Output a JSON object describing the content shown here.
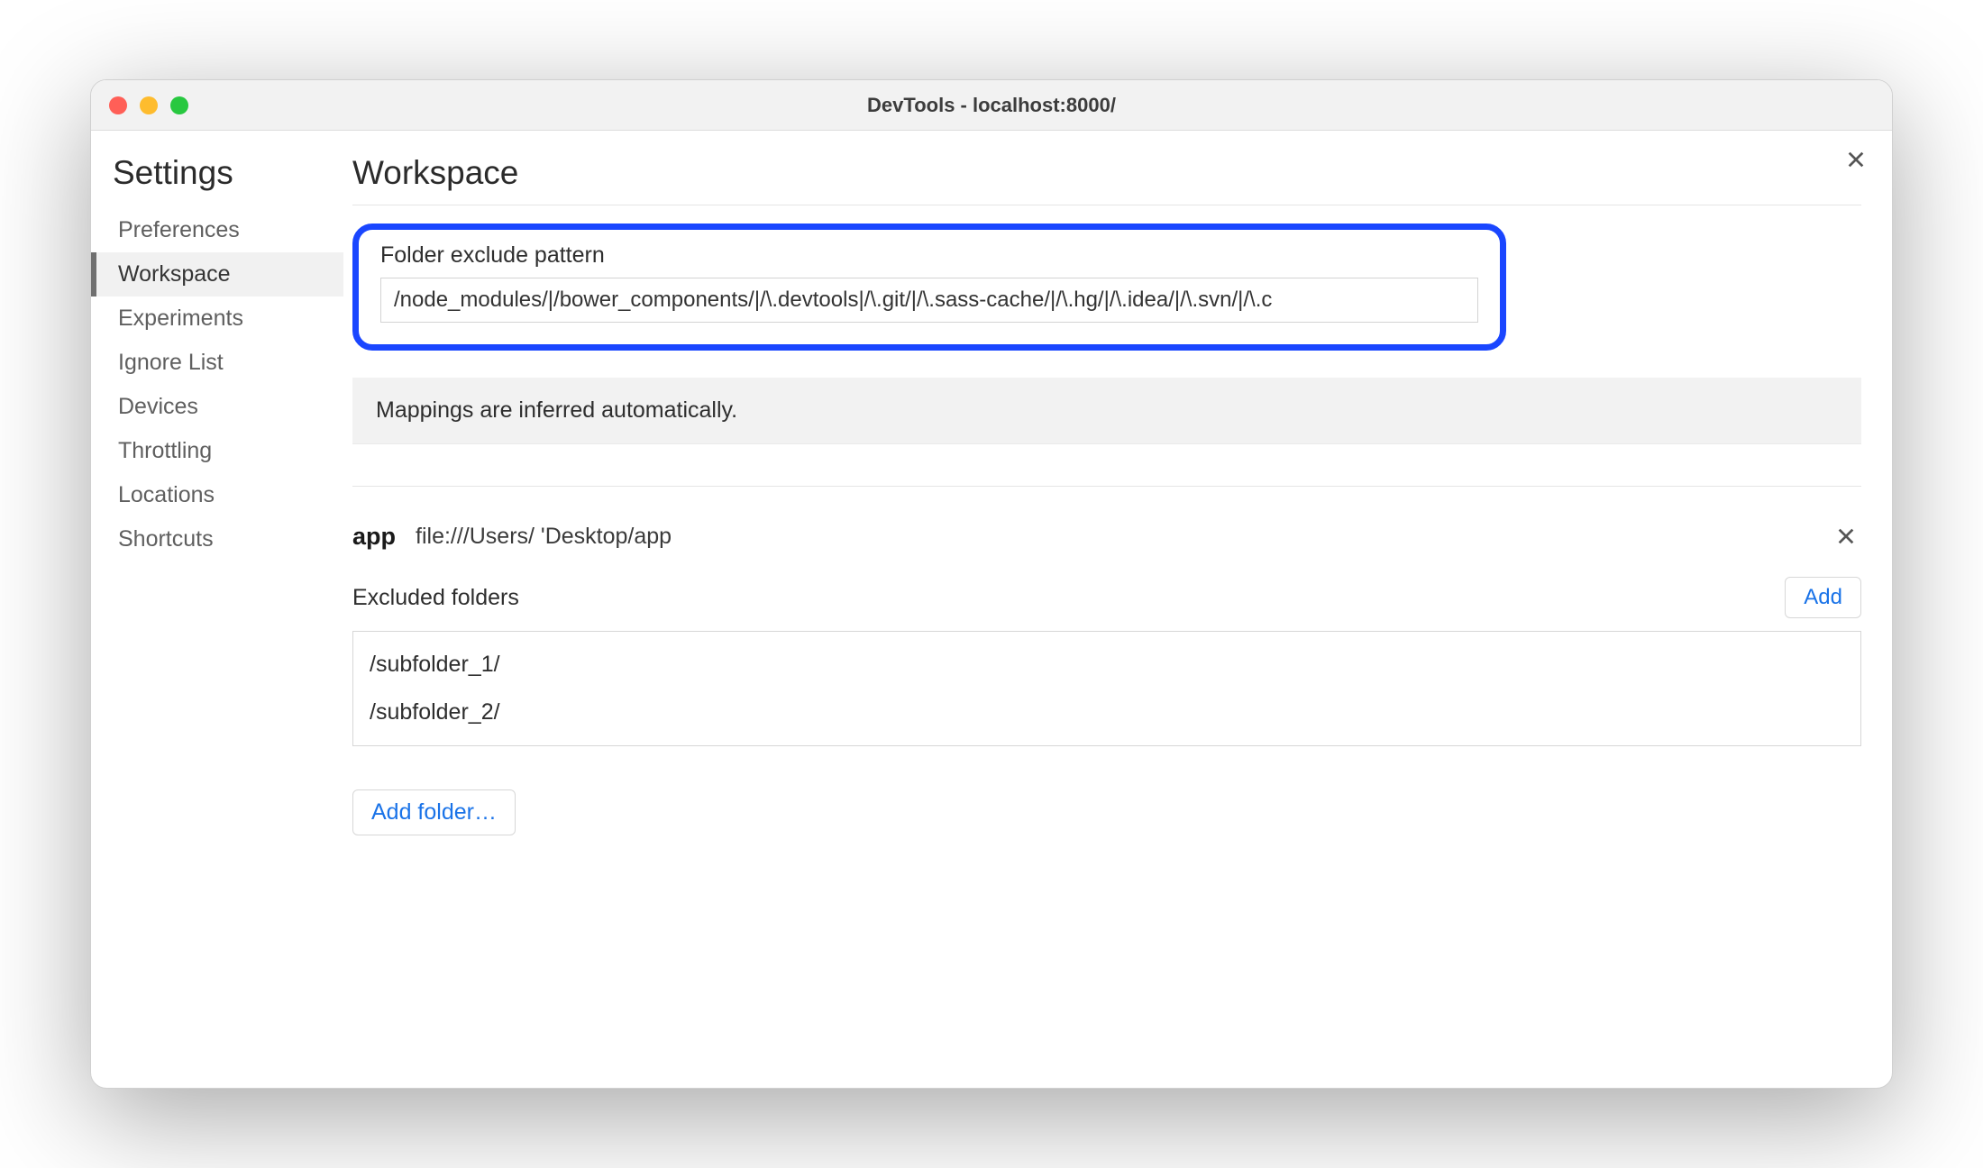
{
  "window": {
    "title": "DevTools - localhost:8000/"
  },
  "sidebar": {
    "heading": "Settings",
    "items": [
      {
        "label": "Preferences"
      },
      {
        "label": "Workspace"
      },
      {
        "label": "Experiments"
      },
      {
        "label": "Ignore List"
      },
      {
        "label": "Devices"
      },
      {
        "label": "Throttling"
      },
      {
        "label": "Locations"
      },
      {
        "label": "Shortcuts"
      }
    ],
    "active_index": 1
  },
  "main": {
    "heading": "Workspace",
    "exclude_pattern": {
      "label": "Folder exclude pattern",
      "value": "/node_modules/|/bower_components/|/\\.devtools|/\\.git/|/\\.sass-cache/|/\\.hg/|/\\.idea/|/\\.svn/|/\\.c"
    },
    "info_banner": "Mappings are inferred automatically.",
    "folder": {
      "name": "app",
      "path": "file:///Users/        'Desktop/app",
      "excluded_label": "Excluded folders",
      "add_button": "Add",
      "excluded": [
        "/subfolder_1/",
        "/subfolder_2/"
      ]
    },
    "add_folder_button": "Add folder…"
  }
}
